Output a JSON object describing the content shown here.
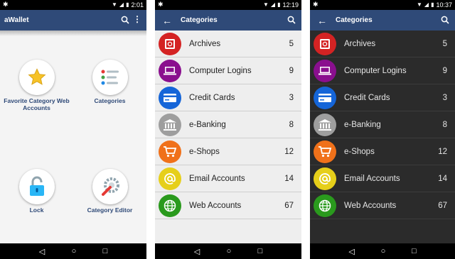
{
  "home": {
    "time": "2:01",
    "app_title": "aWallet",
    "tiles": [
      {
        "label": "Favorite Category Web Accounts",
        "icon": "star-icon"
      },
      {
        "label": "Categories",
        "icon": "list-icon"
      },
      {
        "label": "Lock",
        "icon": "padlock-icon"
      },
      {
        "label": "Category Editor",
        "icon": "wrench-gear-icon"
      }
    ]
  },
  "light": {
    "time": "12:19",
    "title": "Categories"
  },
  "dark": {
    "time": "10:37",
    "title": "Categories"
  },
  "categories": [
    {
      "name": "Archives",
      "count": "5",
      "color": "#d42323",
      "icon": "safe-icon"
    },
    {
      "name": "Computer Logins",
      "count": "9",
      "color": "#8a0f8e",
      "icon": "laptop-icon"
    },
    {
      "name": "Credit Cards",
      "count": "3",
      "color": "#1565d8",
      "icon": "credit-card-icon"
    },
    {
      "name": "e-Banking",
      "count": "8",
      "color": "#9e9e9e",
      "icon": "bank-icon"
    },
    {
      "name": "e-Shops",
      "count": "12",
      "color": "#f0711a",
      "icon": "shopping-cart-icon"
    },
    {
      "name": "Email Accounts",
      "count": "14",
      "color": "#e6cf1a",
      "icon": "at-sign-icon"
    },
    {
      "name": "Web Accounts",
      "count": "67",
      "color": "#2a9a1d",
      "icon": "globe-icon"
    }
  ]
}
